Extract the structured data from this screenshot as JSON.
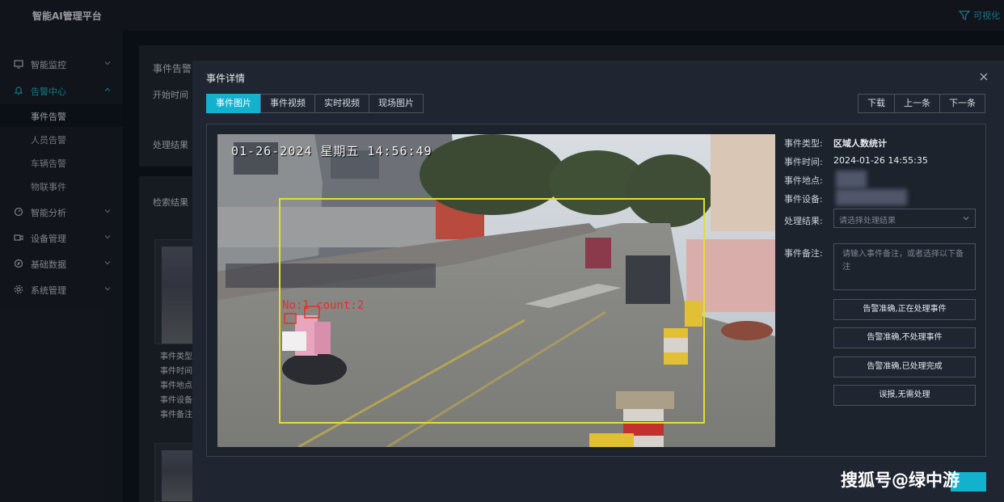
{
  "app": {
    "brand": "智能AI管理平台",
    "visualize_label": "可视化"
  },
  "sidebar": {
    "items": [
      {
        "label": "智能监控",
        "icon": "monitor-icon"
      },
      {
        "label": "告警中心",
        "icon": "bell-icon",
        "expanded": true
      },
      {
        "label": "智能分析",
        "icon": "analysis-icon"
      },
      {
        "label": "设备管理",
        "icon": "camera-icon"
      },
      {
        "label": "基础数据",
        "icon": "compass-icon"
      },
      {
        "label": "系统管理",
        "icon": "gear-icon"
      }
    ],
    "subitems": [
      {
        "label": "事件告警",
        "active": true
      },
      {
        "label": "人员告警"
      },
      {
        "label": "车辆告警"
      },
      {
        "label": "物联事件"
      }
    ]
  },
  "background": {
    "panel_title": "事件告警",
    "start_time_label": "开始时间",
    "result_label": "处理结果",
    "search_results_label": "检索结果",
    "card_fields": [
      "事件类型",
      "事件时间",
      "事件地点",
      "事件设备",
      "事件备注"
    ]
  },
  "modal": {
    "title": "事件详情",
    "tabs": [
      {
        "label": "事件图片",
        "active": true
      },
      {
        "label": "事件视频"
      },
      {
        "label": "实时视频"
      },
      {
        "label": "现场图片"
      }
    ],
    "actions": [
      {
        "label": "下载"
      },
      {
        "label": "上一条"
      },
      {
        "label": "下一条"
      }
    ],
    "image": {
      "osd_text": "01-26-2024 星期五 14:56:49",
      "detection_label": "No:1 count:2",
      "colors": {
        "roi_box": "#e3df2a",
        "detection_box": "#e1322a"
      }
    },
    "details": {
      "event_type_label": "事件类型:",
      "event_type_value": "区域人数统计",
      "event_time_label": "事件时间:",
      "event_time_value": "2024-01-26 14:55:35",
      "event_location_label": "事件地点:",
      "event_device_label": "事件设备:",
      "result_label": "处理结果:",
      "result_placeholder": "请选择处理结果",
      "remark_label": "事件备注:",
      "remark_placeholder": "请输入事件备注，或者选择以下备注"
    },
    "quick_remarks": [
      {
        "label": "告警准确,正在处理事件"
      },
      {
        "label": "告警准确,不处理事件"
      },
      {
        "label": "告警准确,已处理完成"
      },
      {
        "label": "误报,无需处理"
      }
    ]
  },
  "watermark": "搜狐号@绿中游",
  "colors": {
    "accent": "#12b2ce",
    "background": "#101722",
    "panel": "#1f2631"
  }
}
